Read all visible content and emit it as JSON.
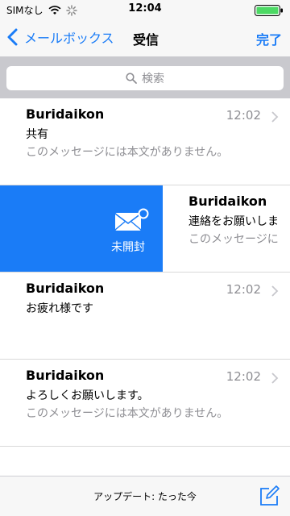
{
  "status": {
    "carrier": "SIMなし",
    "time": "12:04"
  },
  "nav": {
    "back_label": "メールボックス",
    "title": "受信",
    "done_label": "完了"
  },
  "search": {
    "placeholder": "検索"
  },
  "messages": [
    {
      "sender": "Buridaikon",
      "time": "12:02",
      "subject": "共有",
      "preview": "このメッセージには本文がありません。"
    },
    {
      "sender": "Buridaikon",
      "subject": "連絡をお願いしま",
      "preview": "このメッセージに"
    },
    {
      "sender": "Buridaikon",
      "time": "12:02",
      "subject": "お疲れ様です",
      "preview": ""
    },
    {
      "sender": "Buridaikon",
      "time": "12:02",
      "subject": "よろしくお願いします。",
      "preview": "このメッセージには本文がありません。"
    }
  ],
  "swipe_action": {
    "label": "未開封",
    "icon": "mail-unread-icon",
    "color": "#1a7cf7"
  },
  "toolbar": {
    "updated_text": "アップデート: たった今"
  },
  "colors": {
    "accent": "#1a7cf7",
    "secondary_text": "#8e8e93"
  }
}
